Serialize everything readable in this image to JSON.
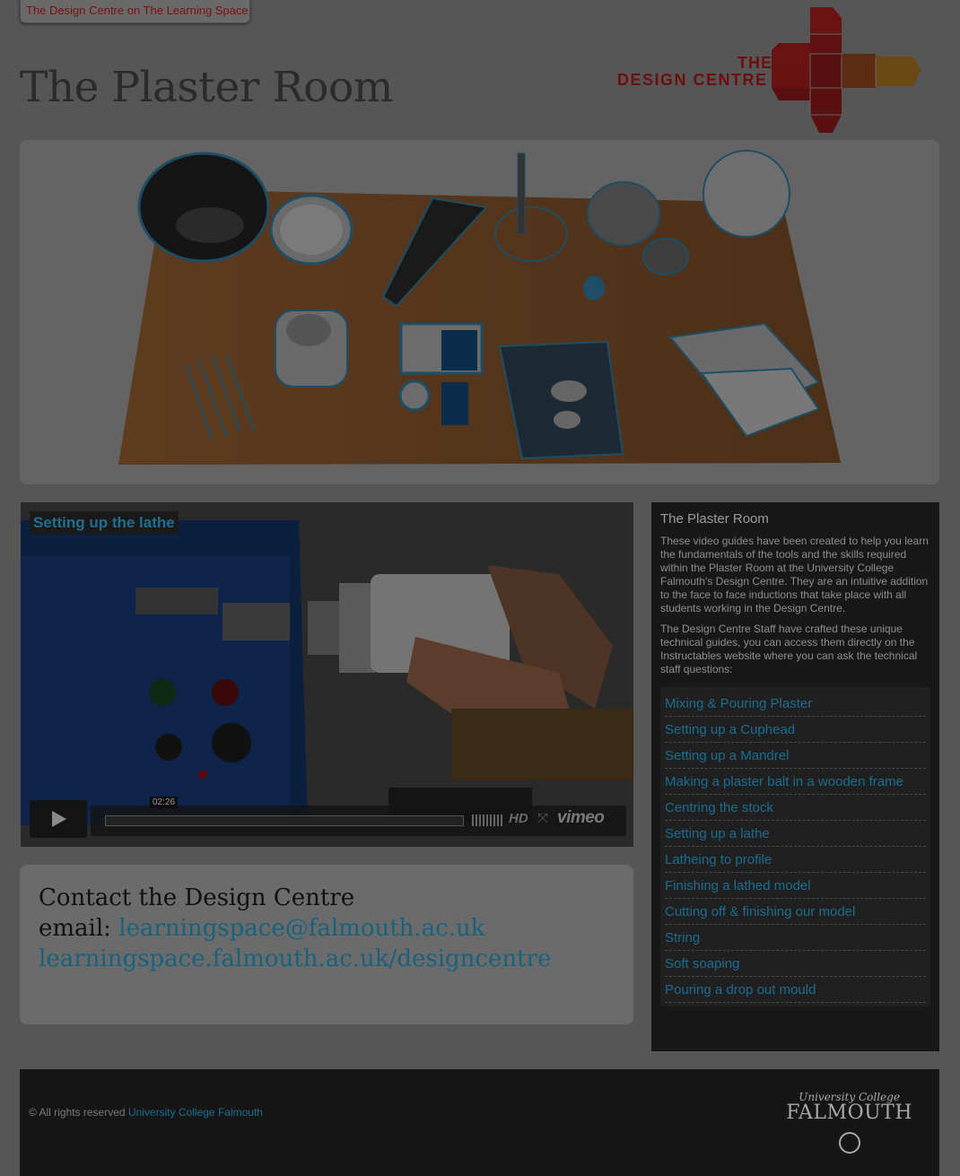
{
  "top_link": {
    "label": "The Design Centre on The Learning Space"
  },
  "page_title": "The Plaster Room",
  "logo": {
    "line1": "THE",
    "line2": "DESIGN CENTRE"
  },
  "video": {
    "title": "Setting up the lathe",
    "timecode": "02:26",
    "hd_label": "HD",
    "brand": "vimeo"
  },
  "sidebar": {
    "heading": "The Plaster Room",
    "para1": "These video guides have been created to help you learn the fundamentals of the tools and the skills required within the Plaster Room at the University College Falmouth's Design Centre. They are an intuitive addition to the face to face inductions that take place with all students working in the Design Centre.",
    "para2": "The Design Centre Staff have crafted these unique technical guides, you can access them directly on the Instructables website where you can ask the technical staff questions:",
    "guides": [
      "Mixing & Pouring Plaster",
      "Setting up a Cuphead",
      "Setting up a Mandrel",
      "Making a plaster balt in a wooden frame",
      "Centring the stock",
      "Setting up a lathe",
      "Latheing to profile",
      "Finishing a lathed model",
      "Cutting off & finishing our model",
      "String",
      "Soft soaping",
      "Pouring a drop out mould"
    ]
  },
  "contact": {
    "heading": "Contact the Design Centre",
    "email_label": "email:",
    "email": "learningspace@falmouth.ac.uk",
    "url": "learningspace.falmouth.ac.uk/designcentre"
  },
  "footer": {
    "copyright": "© All rights reserved",
    "org_link": "University College Falmouth",
    "logo_top": "University College",
    "logo_bottom": "FALMOUTH"
  },
  "colors": {
    "link": "#1b6d91",
    "brand_red": "#6e0f0f"
  }
}
